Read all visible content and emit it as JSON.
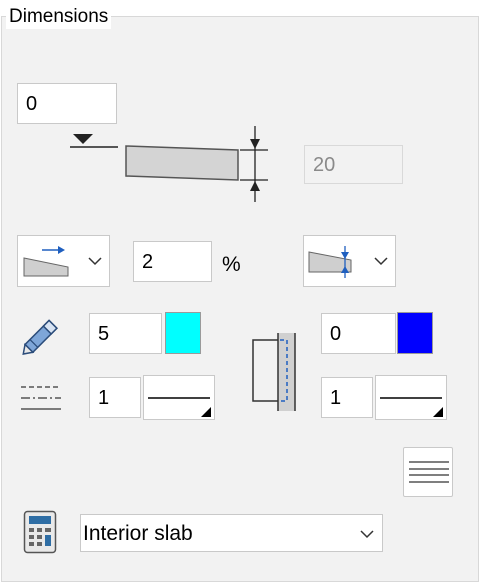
{
  "panel": {
    "title": "Dimensions"
  },
  "elevation": {
    "value": "0"
  },
  "thickness": {
    "value": "20"
  },
  "slope": {
    "value": "2",
    "unit": "%"
  },
  "pen": {
    "value": "5",
    "color": "#00ffff"
  },
  "outline_pen": {
    "value": "0",
    "color": "#0000ff"
  },
  "line_weight_left": {
    "value": "1"
  },
  "line_weight_right": {
    "value": "1"
  },
  "slab_type": {
    "selected": "Interior slab"
  },
  "icons": {
    "slope_type": "slope-arrow-icon",
    "thickness_dir": "thickness-arrow-icon",
    "pen": "pencil-icon",
    "line_type": "dashed-lines-icon",
    "wall_section": "section-icon",
    "fill": "hatch-lines-icon",
    "calculator": "calculator-icon"
  }
}
